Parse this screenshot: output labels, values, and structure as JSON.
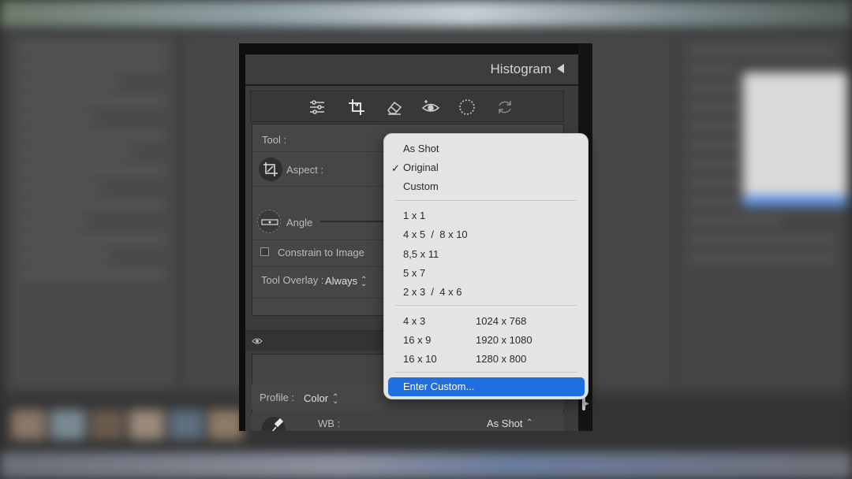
{
  "panel": {
    "histogram_title": "Histogram",
    "tool_label": "Tool :",
    "aspect_label": "Aspect :",
    "angle_label": "Angle",
    "constrain_label": "Constrain to Image",
    "tool_overlay_label": "Tool Overlay :",
    "tool_overlay_value": "Always",
    "profile_label": "Profile :",
    "profile_value": "Color",
    "wb_label": "WB :",
    "wb_value": "As Shot"
  },
  "menu": {
    "groups": [
      {
        "items": [
          {
            "label": "As Shot",
            "checked": false
          },
          {
            "label": "Original",
            "checked": true
          },
          {
            "label": "Custom",
            "checked": false
          }
        ]
      },
      {
        "items": [
          {
            "label": "1 x 1"
          },
          {
            "label": "4 x 5  /  8 x 10"
          },
          {
            "label": "8,5 x 11"
          },
          {
            "label": "5 x 7"
          },
          {
            "label": "2 x 3  /  4 x 6"
          }
        ]
      },
      {
        "items": [
          {
            "label": "4 x 3",
            "pixels": "1024 x 768"
          },
          {
            "label": "16 x 9",
            "pixels": "1920 x 1080"
          },
          {
            "label": "16 x 10",
            "pixels": "1280 x 800"
          }
        ]
      }
    ],
    "enter_custom": "Enter Custom...",
    "check_glyph": "✓"
  },
  "colors": {
    "highlight": "#1f6fe0",
    "menu_bg": "#e4e4e4",
    "panel_bg": "#3c3c3c"
  }
}
